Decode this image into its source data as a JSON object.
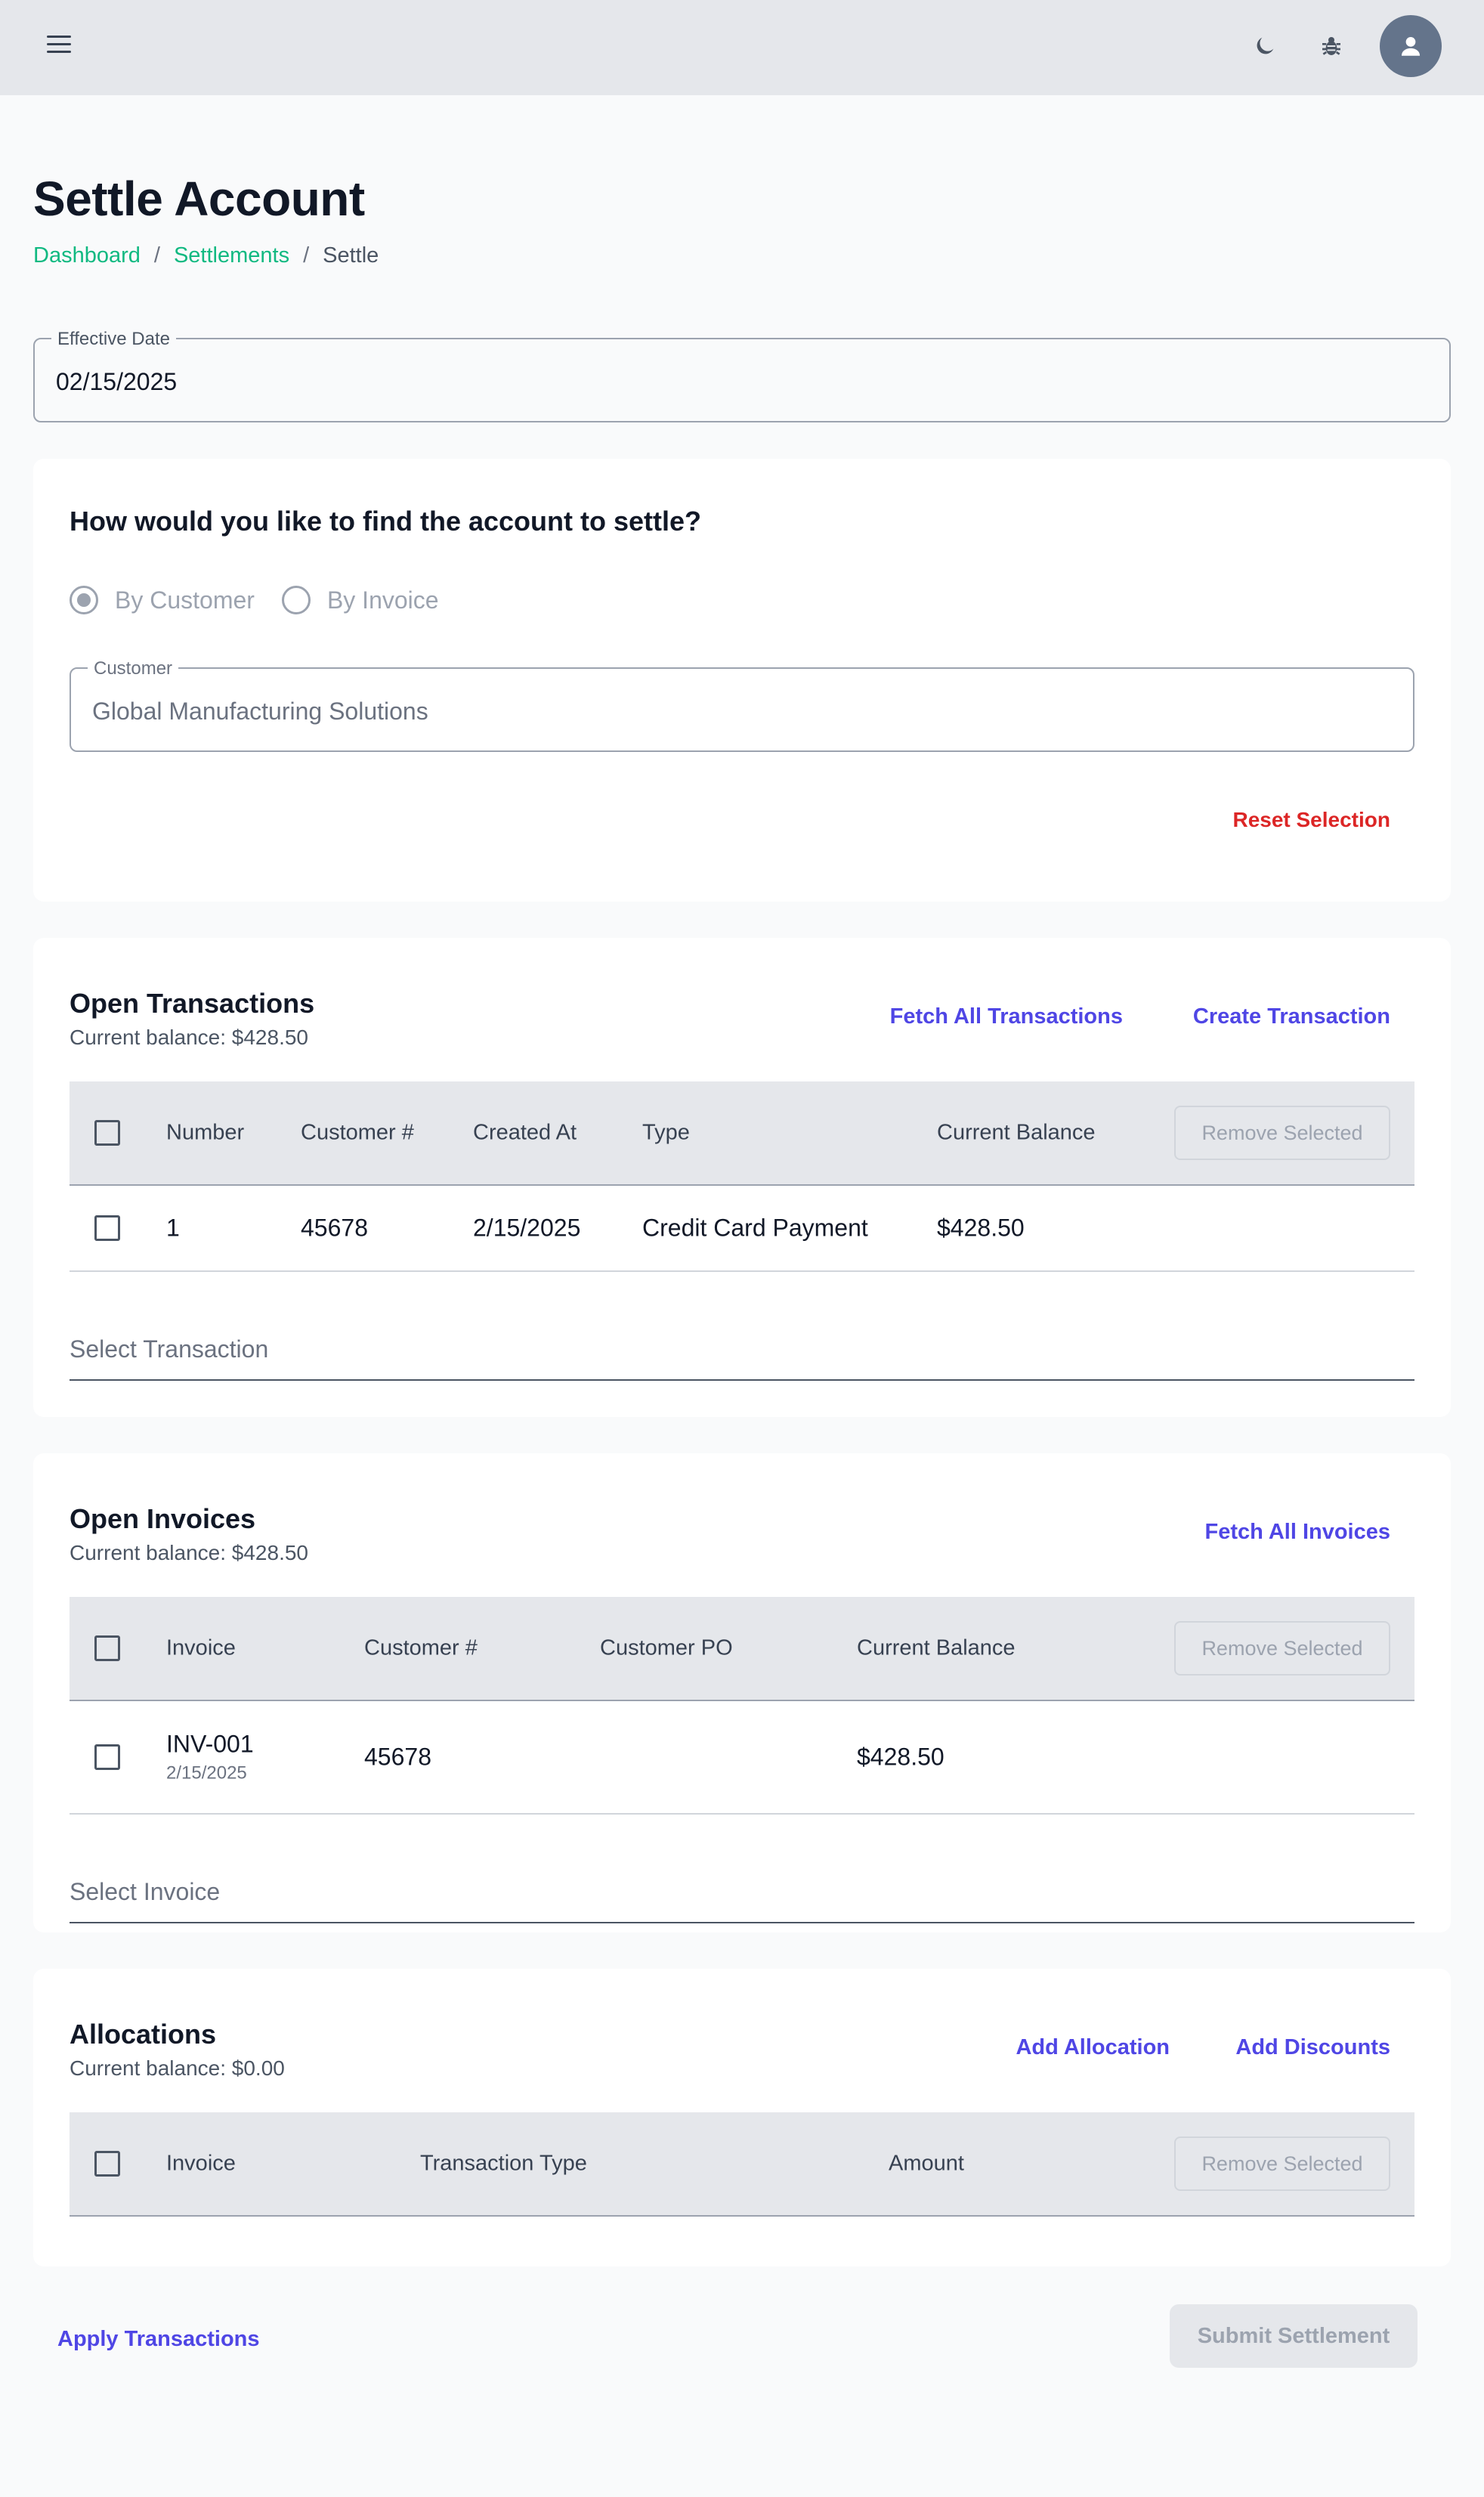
{
  "header": {
    "menu_icon": "hamburger-menu-icon",
    "theme_icon": "moon-icon",
    "debug_icon": "bug-icon",
    "avatar_icon": "user-icon"
  },
  "page": {
    "title": "Settle Account",
    "breadcrumb": [
      "Dashboard",
      "Settlements",
      "Settle"
    ]
  },
  "effective_date": {
    "label": "Effective Date",
    "value": "02/15/2025"
  },
  "find": {
    "question": "How would you like to find the account to settle?",
    "options": [
      "By Customer",
      "By Invoice"
    ],
    "selected": "By Customer",
    "customer_label": "Customer",
    "customer_value": "Global Manufacturing Solutions",
    "reset_label": "Reset Selection"
  },
  "transactions": {
    "title": "Open Transactions",
    "balance": "Current balance: $428.50",
    "fetch_label": "Fetch All Transactions",
    "create_label": "Create Transaction",
    "columns": [
      "Number",
      "Customer #",
      "Created At",
      "Type",
      "Current Balance"
    ],
    "remove_label": "Remove Selected",
    "rows": [
      {
        "number": "1",
        "customer": "45678",
        "created": "2/15/2025",
        "type": "Credit Card Payment",
        "balance": "$428.50"
      }
    ],
    "select_placeholder": "Select Transaction"
  },
  "invoices": {
    "title": "Open Invoices",
    "balance": "Current balance: $428.50",
    "fetch_label": "Fetch All Invoices",
    "columns": [
      "Invoice",
      "Customer #",
      "Customer PO",
      "Current Balance"
    ],
    "remove_label": "Remove Selected",
    "rows": [
      {
        "invoice": "INV-001",
        "date": "2/15/2025",
        "customer": "45678",
        "po": "",
        "balance": "$428.50"
      }
    ],
    "select_placeholder": "Select Invoice"
  },
  "allocations": {
    "title": "Allocations",
    "balance": "Current balance: $0.00",
    "add_allocation_label": "Add Allocation",
    "add_discounts_label": "Add Discounts",
    "columns": [
      "Invoice",
      "Transaction Type",
      "Amount"
    ],
    "remove_label": "Remove Selected"
  },
  "footer": {
    "apply_label": "Apply Transactions",
    "submit_label": "Submit Settlement"
  },
  "colors": {
    "accent": "#4f46e5",
    "breadcrumb_link": "#10b981",
    "danger": "#dc2626",
    "header_bg": "#e5e7eb"
  }
}
